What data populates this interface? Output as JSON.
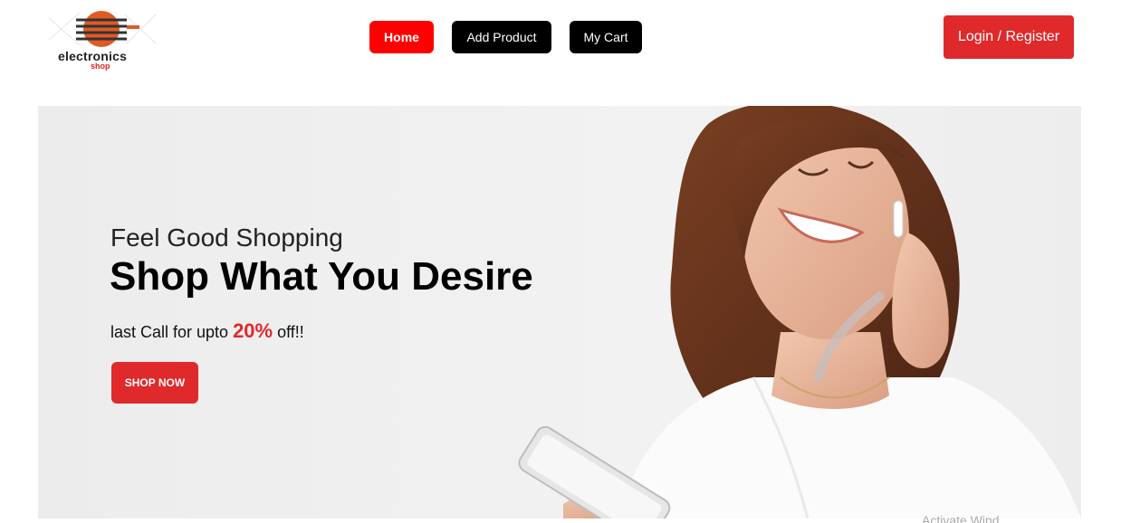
{
  "header": {
    "logo": {
      "word": "electronics",
      "sub": "shop"
    },
    "nav": [
      {
        "label": "Home"
      },
      {
        "label": "Add Product"
      },
      {
        "label": "My Cart"
      }
    ],
    "login_label": "Login / Register"
  },
  "hero": {
    "kicker": "Feel Good Shopping",
    "title": "Shop What You Desire",
    "offer_before": "last Call for upto ",
    "offer_percent": "20%",
    "offer_after": " off!!",
    "cta_label": "SHOP NOW"
  },
  "watermark": "Activate Wind",
  "colors": {
    "accent": "#e0292b",
    "home_button": "#ff0000",
    "nav_button": "#000000"
  }
}
